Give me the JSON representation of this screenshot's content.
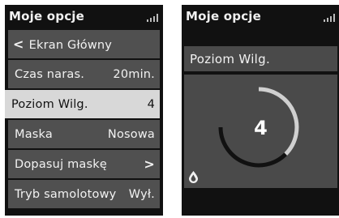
{
  "left_screen": {
    "title": "Moje opcje",
    "back_item": {
      "arrow": "<",
      "label": "Ekran Główny"
    },
    "items": [
      {
        "label": "Czas naras.",
        "value": "20min."
      },
      {
        "label": "Poziom Wilg.",
        "value": "4"
      },
      {
        "label": "Maska",
        "value": "Nosowa"
      },
      {
        "label": "Dopasuj maskę",
        "value": ">"
      },
      {
        "label": "Tryb samolotowy",
        "value": "Wył."
      }
    ],
    "selected_index": 1
  },
  "right_screen": {
    "title": "Moje opcje",
    "panel_title": "Poziom Wilg.",
    "gauge": {
      "value": "4",
      "level": 4,
      "max_level": 8
    },
    "icon": "water-drop-icon"
  },
  "colors": {
    "screen_bg": "#111111",
    "item_bg": "#505050",
    "selected_bg": "#d8d8d8",
    "gauge_fill": "#111111",
    "gauge_track": "#d0d0d0"
  }
}
